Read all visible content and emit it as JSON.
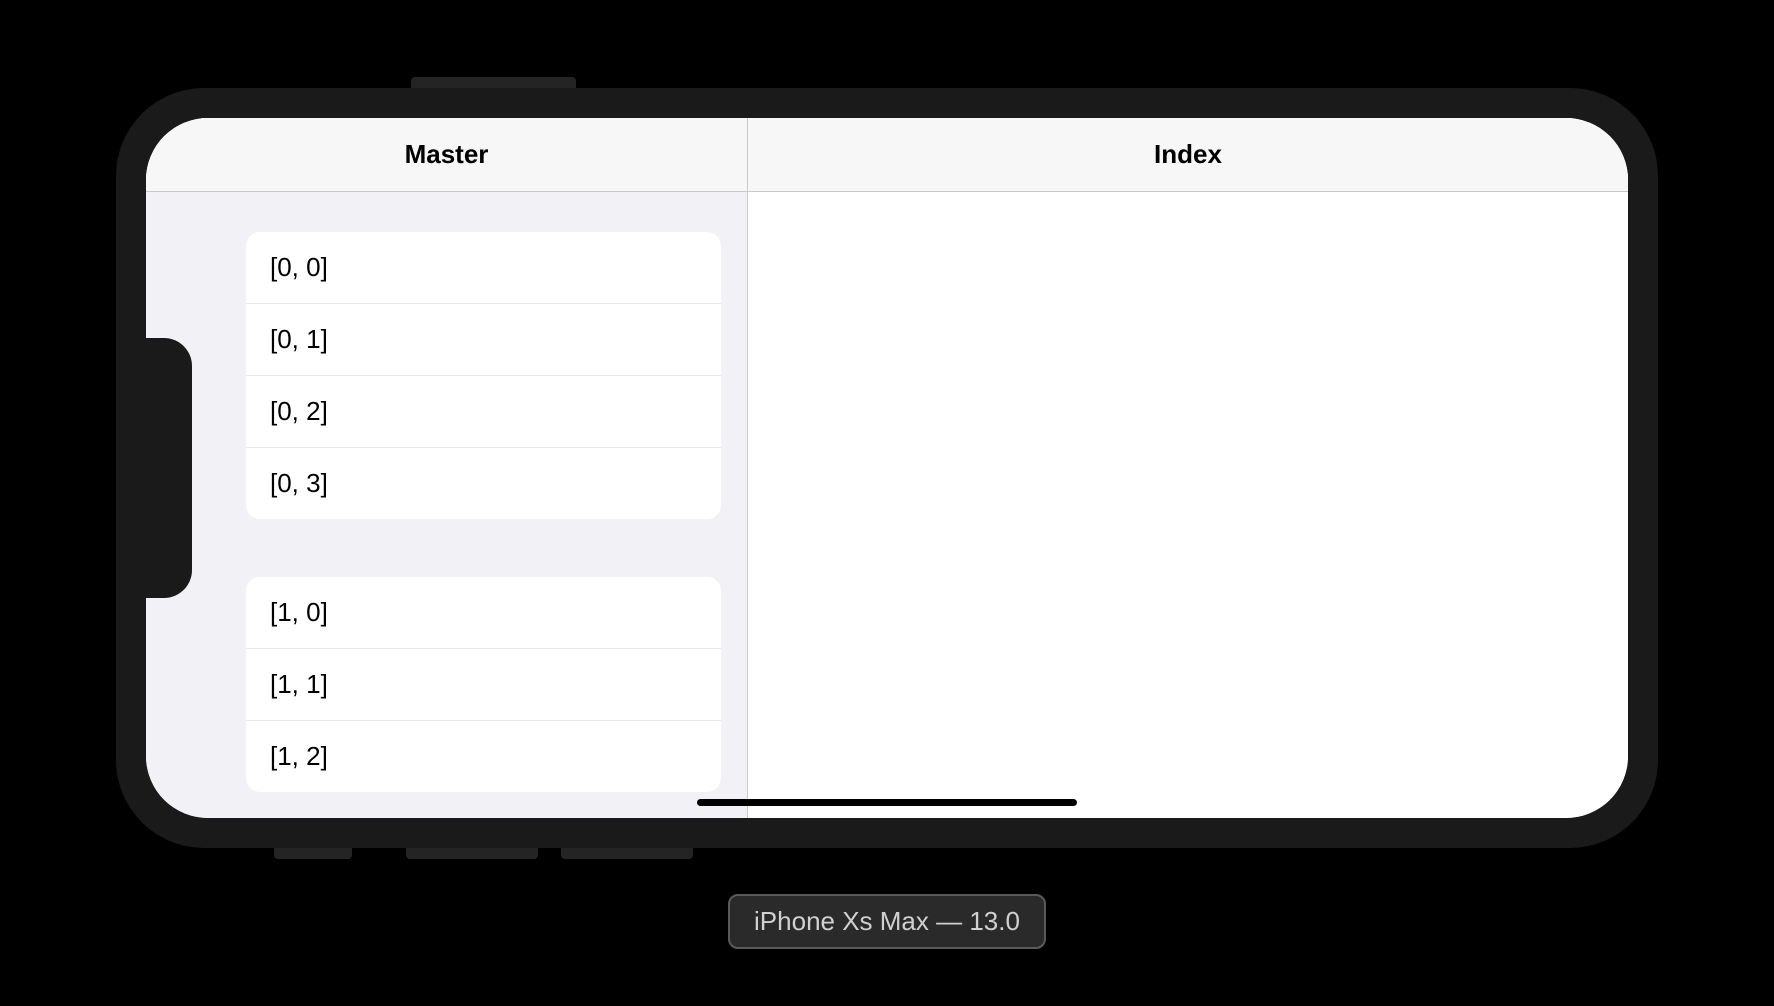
{
  "master": {
    "title": "Master",
    "sections": [
      {
        "rows": [
          "[0, 0]",
          "[0, 1]",
          "[0, 2]",
          "[0, 3]"
        ]
      },
      {
        "rows": [
          "[1, 0]",
          "[1, 1]",
          "[1, 2]"
        ]
      }
    ]
  },
  "detail": {
    "title": "Index"
  },
  "device_label": "iPhone Xs Max — 13.0"
}
